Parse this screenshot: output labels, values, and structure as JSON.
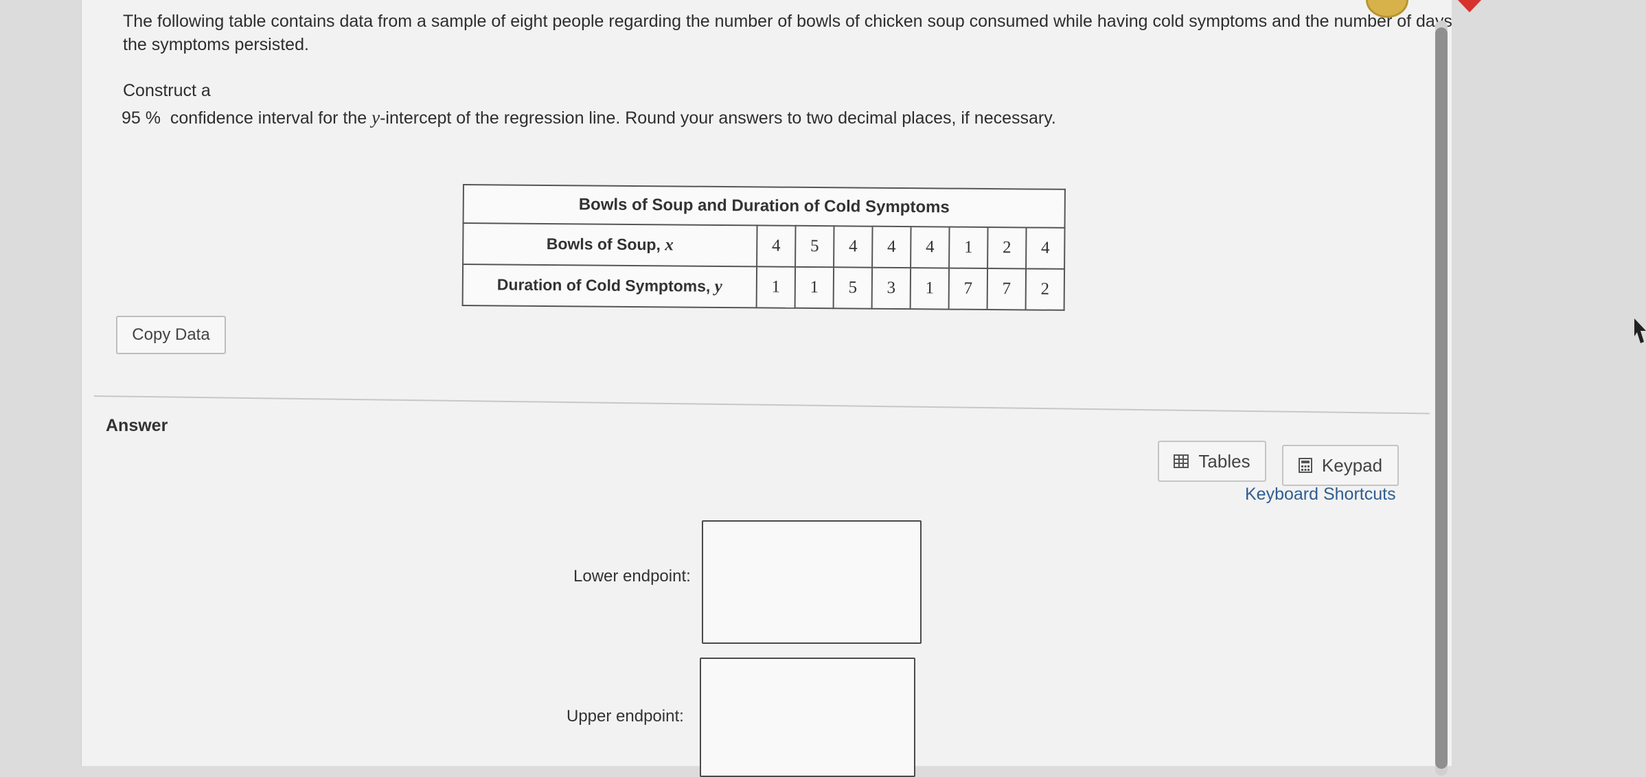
{
  "question": {
    "intro": "The following table contains data from a sample of eight people regarding the number of bowls of chicken soup consumed while having cold symptoms and the number of days the symptoms persisted.",
    "construct": "Construct a",
    "ci_level": "95 %",
    "ci_text_before": "confidence interval for the ",
    "ci_var": "y",
    "ci_text_after": "-intercept of the regression line. Round your answers to two decimal places, if necessary."
  },
  "table": {
    "title": "Bowls of Soup and Duration of Cold Symptoms",
    "rows": [
      {
        "label": "Bowls of Soup, ",
        "var": "x",
        "values": [
          "4",
          "5",
          "4",
          "4",
          "4",
          "1",
          "2",
          "4"
        ]
      },
      {
        "label": "Duration of Cold Symptoms, ",
        "var": "y",
        "values": [
          "1",
          "1",
          "5",
          "3",
          "1",
          "7",
          "7",
          "2"
        ]
      }
    ]
  },
  "buttons": {
    "copy_data": "Copy Data",
    "tables": "Tables",
    "keypad": "Keypad",
    "keyboard_shortcuts": "Keyboard Shortcuts"
  },
  "answer": {
    "heading": "Answer",
    "lower_label": "Lower endpoint:",
    "upper_label": "Upper endpoint:",
    "lower_value": "",
    "upper_value": ""
  },
  "colors": {
    "page_bg": "#f2f2f2",
    "outer_bg": "#dcdcdc",
    "link": "#2f5d92",
    "border": "#555555"
  }
}
